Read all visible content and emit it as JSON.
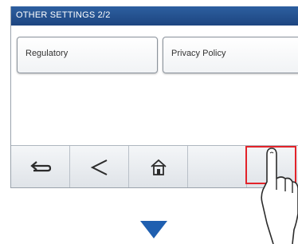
{
  "header": {
    "title": "OTHER SETTINGS  2/2"
  },
  "settings": {
    "items": [
      {
        "label": "Regulatory"
      },
      {
        "label": "Privacy Policy"
      }
    ]
  },
  "bottom_bar": {
    "buttons": [
      {
        "icon": "return-icon"
      },
      {
        "icon": "back-chevron-icon"
      },
      {
        "icon": "home-icon"
      },
      {
        "icon": "none"
      },
      {
        "icon": "none"
      }
    ]
  },
  "annotations": {
    "highlight_color": "#e2232a",
    "arrow_color": "#1f5fb0",
    "pointer_icon": "pointing-hand-icon",
    "down_arrow_icon": "down-arrow-icon"
  },
  "colors": {
    "title_bar": "#2d5fa0",
    "button_border": "#8b939c"
  }
}
